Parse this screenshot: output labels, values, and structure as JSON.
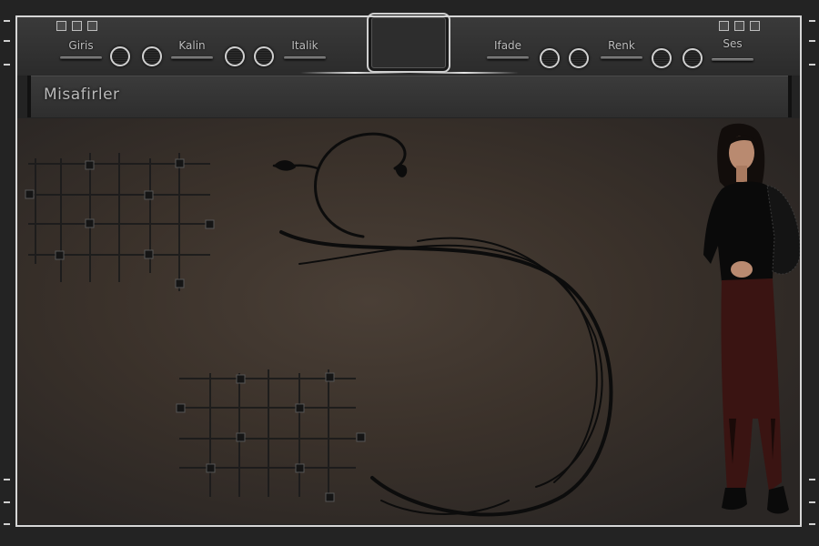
{
  "window": {
    "title": "Misafirler"
  },
  "nav": {
    "items": [
      {
        "label": "Giris"
      },
      {
        "label": "Kalin"
      },
      {
        "label": "Italik"
      },
      {
        "label": "Ifade"
      },
      {
        "label": "Renk"
      },
      {
        "label": "Ses"
      }
    ]
  },
  "icons": {
    "knob": "round-dial-icon",
    "window_buttons": "small-square-icon",
    "rail_ticks": "rail-tick-icon"
  },
  "colors": {
    "frame": "#d6d6d6",
    "header_bg": "#2f2f2f",
    "content_bg": "#3a312a",
    "text": "#bdbdbd"
  }
}
